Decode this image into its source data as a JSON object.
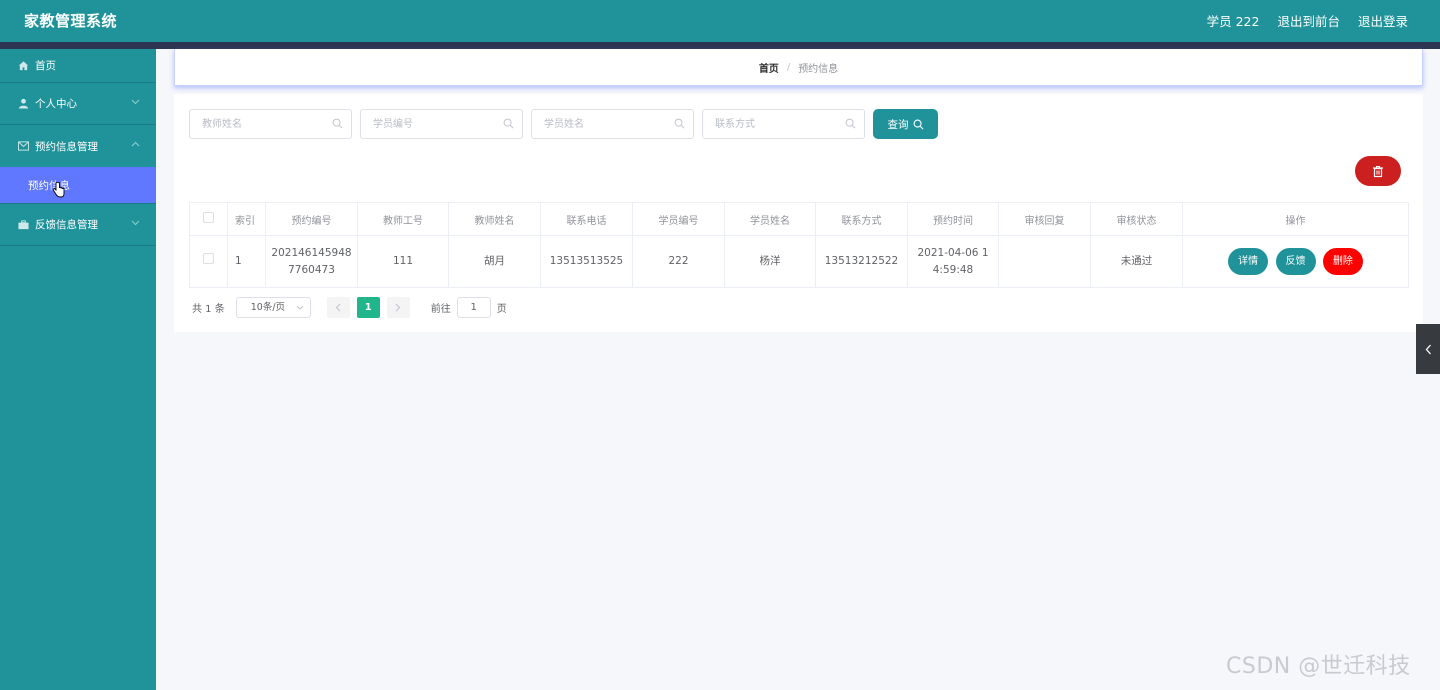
{
  "header": {
    "title": "家教管理系统",
    "user_label": "学员 222",
    "front_link": "退出到前台",
    "logout_link": "退出登录"
  },
  "sidebar": {
    "items": [
      {
        "label": "首页",
        "icon": "home-icon"
      },
      {
        "label": "个人中心",
        "icon": "user-icon"
      },
      {
        "label": "预约信息管理",
        "icon": "mail-icon",
        "children": [
          {
            "label": "预约信息",
            "active": true
          }
        ]
      },
      {
        "label": "反馈信息管理",
        "icon": "briefcase-icon"
      }
    ]
  },
  "breadcrumb": {
    "home": "首页",
    "separator": "/",
    "current": "预约信息"
  },
  "search": {
    "teacher_name_placeholder": "教师姓名",
    "student_id_placeholder": "学员编号",
    "student_name_placeholder": "学员姓名",
    "contact_placeholder": "联系方式",
    "query_label": "查询"
  },
  "table": {
    "headers": [
      "索引",
      "预约编号",
      "教师工号",
      "教师姓名",
      "联系电话",
      "学员编号",
      "学员姓名",
      "联系方式",
      "预约时间",
      "审核回复",
      "审核状态",
      "操作"
    ],
    "rows": [
      {
        "index": "1",
        "booking_no_line1": "202146145948",
        "booking_no_line2": "7760473",
        "teacher_id": "111",
        "teacher_name": "胡月",
        "phone": "13513513525",
        "student_id": "222",
        "student_name": "杨洋",
        "contact": "13513212522",
        "time_line1": "2021-04-06 1",
        "time_line2": "4:59:48",
        "review_reply": "",
        "review_status": "未通过",
        "actions": {
          "detail": "详情",
          "feedback": "反馈",
          "delete": "删除"
        }
      }
    ]
  },
  "pagination": {
    "total_text": "共 1 条",
    "page_size": "10条/页",
    "current_page": "1",
    "goto_label": "前往",
    "goto_value": "1",
    "page_suffix": "页"
  },
  "watermark": "CSDN @世迁科技",
  "colors": {
    "primary": "#20939a",
    "active_menu": "#6077ff",
    "danger": "#ff0000",
    "page_active": "#20b58a"
  }
}
